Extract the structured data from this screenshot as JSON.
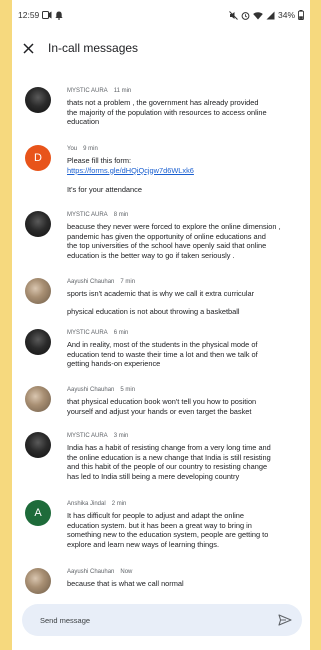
{
  "status": {
    "time": "12:59",
    "battery": "34%"
  },
  "header": {
    "title": "In-call messages"
  },
  "messages": [
    {
      "sender": "MYSTIC AURA",
      "time": "11 min",
      "lines": [
        "thats not a problem , the government has already provided",
        "the majority of the population with resources to access online",
        "education"
      ]
    },
    {
      "sender": "You",
      "time": "9 min",
      "avatar_letter": "D",
      "lines": [
        "Please fill this form:"
      ],
      "link": "https://forms.gle/dHQiQcjgw7d6WLxk6",
      "extra": "It's for your attendance"
    },
    {
      "sender": "MYSTIC AURA",
      "time": "8 min",
      "lines": [
        "beacuse they never were forced to explore the online dimension ,",
        "pandemic has given the opportunity of online educations and",
        "the top universities of the school have openly said that online",
        "education is the better way to go if taken seriously ."
      ]
    },
    {
      "sender": "Aayushi Chauhan",
      "time": "7 min",
      "lines": [
        "sports isn't academic that is why we call it extra curricular"
      ],
      "extra": "physical education is not about throwing a basketball"
    },
    {
      "sender": "MYSTIC AURA",
      "time": "6 min",
      "lines": [
        "And in reality, most of the students in the physical mode of",
        "education tend to waste their time a lot and then we talk of",
        "getting hands-on experience"
      ]
    },
    {
      "sender": "Aayushi Chauhan",
      "time": "5 min",
      "lines": [
        "that physical education book won't tell you how to position",
        "yourself and adjust your hands or even target the basket"
      ]
    },
    {
      "sender": "MYSTIC AURA",
      "time": "3 min",
      "lines": [
        "India has a habit of resisting change from a very long time and",
        "the online education is a new change that India is still resisting",
        "and this habit of the people of our country to resisting change",
        "has led to India still being a mere developing country"
      ]
    },
    {
      "sender": "Anshika Jindal",
      "time": "2 min",
      "avatar_letter": "A",
      "lines": [
        "It has difficult for people to adjust and adapt the online",
        "education system. but it has been a great way to bring in",
        "something new to the education system, people are getting to",
        "explore and learn new ways of learning things."
      ]
    },
    {
      "sender": "Aayushi Chauhan",
      "time": "Now",
      "lines": [
        "because that is what we call normal"
      ]
    }
  ],
  "composer": {
    "placeholder": "Send message"
  },
  "icons": {
    "close": "close-icon",
    "send": "send-icon"
  }
}
